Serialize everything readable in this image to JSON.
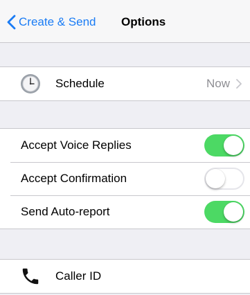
{
  "navbar": {
    "back_label": "Create & Send",
    "title": "Options",
    "accent_color": "#1a7cf5"
  },
  "schedule": {
    "icon": "clock-icon",
    "label": "Schedule",
    "value": "Now"
  },
  "toggles": [
    {
      "label": "Accept Voice Replies",
      "on": true
    },
    {
      "label": "Accept Confirmation",
      "on": false
    },
    {
      "label": "Send Auto-report",
      "on": true
    }
  ],
  "caller_id": {
    "icon": "phone-icon",
    "label": "Caller ID"
  },
  "colors": {
    "toggle_on": "#4cd964",
    "background": "#efeff4"
  }
}
